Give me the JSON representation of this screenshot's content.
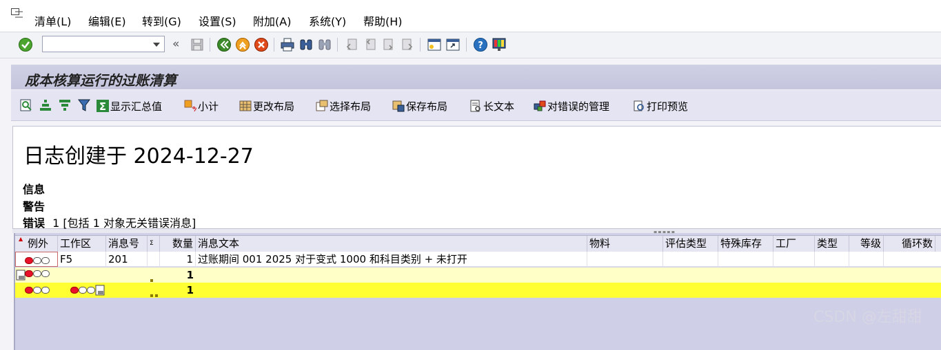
{
  "menu": {
    "items": [
      "清单(L)",
      "编辑(E)",
      "转到(G)",
      "设置(S)",
      "附加(A)",
      "系统(Y)",
      "帮助(H)"
    ]
  },
  "toolbar": {
    "command_field_value": "",
    "collapse_glyph": "«",
    "icons": [
      "ok-check-icon",
      "save-icon",
      "back-icon",
      "exit-icon",
      "cancel-icon",
      "print-icon",
      "find-icon",
      "find-next-icon",
      "first-page-icon",
      "previous-page-icon",
      "next-page-icon",
      "last-page-icon",
      "create-session-icon",
      "shortcut-icon",
      "help-icon",
      "layout-menu-icon"
    ]
  },
  "title": "成本核算运行的过账清算",
  "alv_toolbar": {
    "buttons": [
      {
        "label": "显示汇总值",
        "icon": "sum-icon"
      },
      {
        "label": "小计",
        "icon": "subtotal-icon"
      },
      {
        "label": "更改布局",
        "icon": "change-layout-icon"
      },
      {
        "label": "选择布局",
        "icon": "select-layout-icon"
      },
      {
        "label": "保存布局",
        "icon": "save-layout-icon"
      },
      {
        "label": "长文本",
        "icon": "long-text-icon"
      },
      {
        "label": "对错误的管理",
        "icon": "error-management-icon"
      },
      {
        "label": "打印预览",
        "icon": "print-preview-icon"
      }
    ]
  },
  "header": {
    "log_title": "日志创建于 2024-12-27",
    "info_label": "信息",
    "warning_label": "警告",
    "error_label": "错误",
    "error_text": "1 [包括 1 对象无关错误消息]"
  },
  "grid": {
    "columns": [
      "例外",
      "工作区",
      "消息号",
      "Σ",
      "数量",
      "消息文本",
      "物料",
      "评估类型",
      "特殊库存",
      "工厂",
      "类型",
      "等级",
      "循环数"
    ],
    "rows": [
      {
        "area": "F5",
        "msg_no": "201",
        "qty": "1",
        "text": "过账期间 001 2025 对于变式 1000 和科目类别 + 未打开"
      }
    ],
    "subtotal_qty": "1",
    "total_qty": "1"
  },
  "watermark": "CSDN @左甜甜"
}
